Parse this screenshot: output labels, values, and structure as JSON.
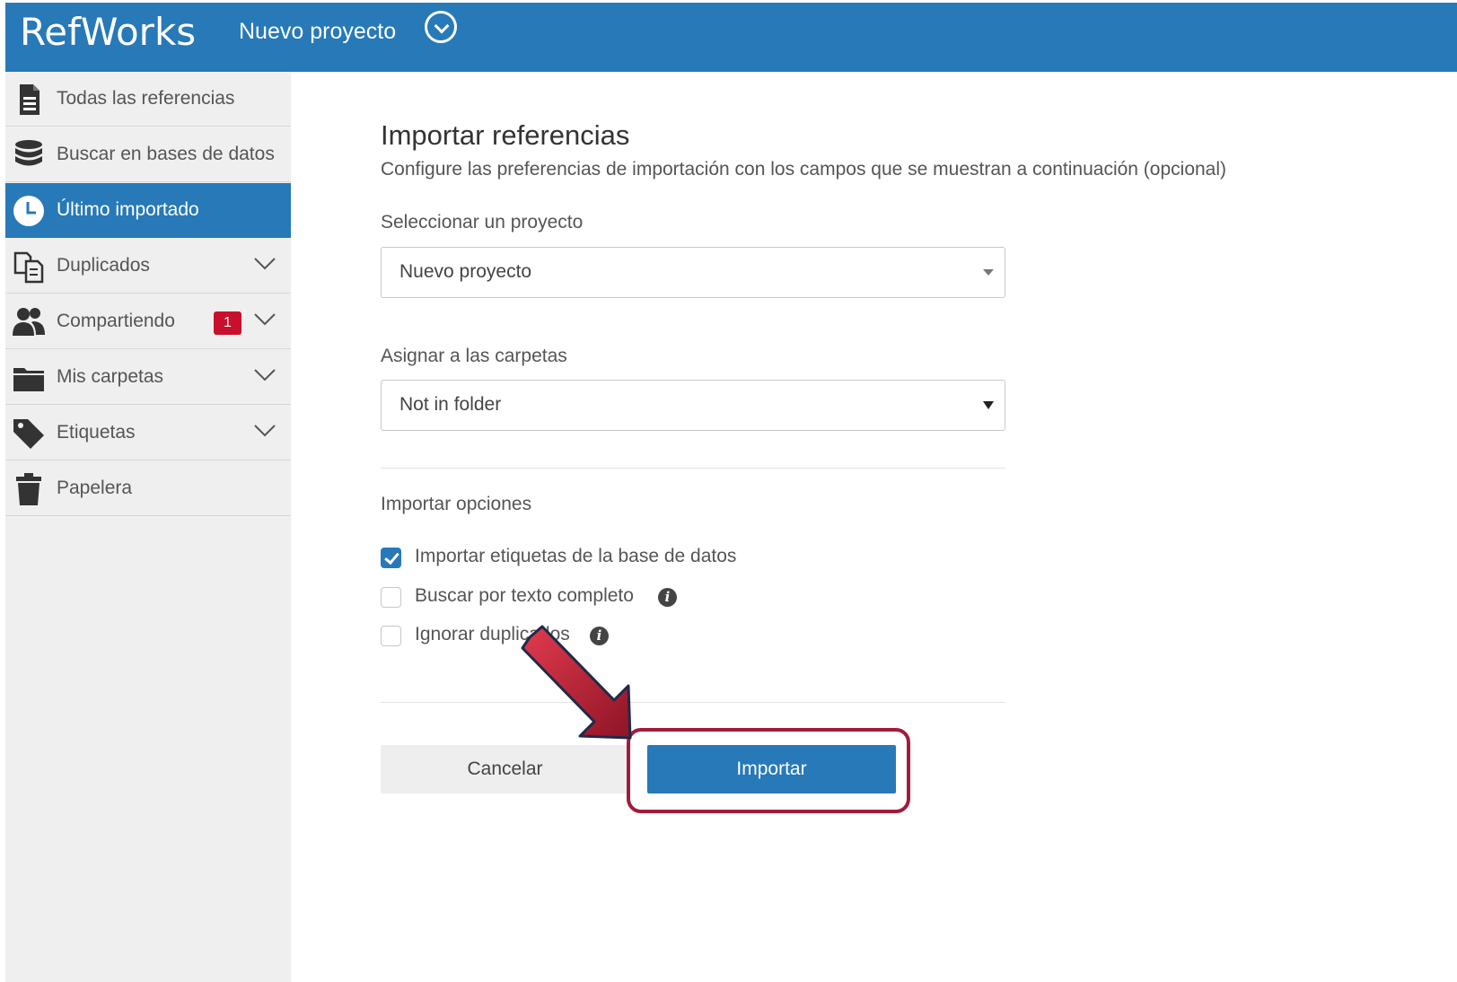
{
  "header": {
    "logo": "RefWorks",
    "project_name": "Nuevo proyecto"
  },
  "sidebar": {
    "items": [
      {
        "label": "Todas las referencias",
        "icon": "document-icon"
      },
      {
        "label": "Buscar en bases de datos",
        "icon": "database-icon"
      },
      {
        "label": "Último importado",
        "icon": "clock-icon",
        "active": true
      },
      {
        "label": "Duplicados",
        "icon": "duplicate-icon",
        "expandable": true
      },
      {
        "label": "Compartiendo",
        "icon": "users-icon",
        "expandable": true,
        "badge": "1"
      },
      {
        "label": "Mis carpetas",
        "icon": "folder-icon",
        "expandable": true
      },
      {
        "label": "Etiquetas",
        "icon": "tag-icon",
        "expandable": true
      },
      {
        "label": "Papelera",
        "icon": "trash-icon"
      }
    ]
  },
  "main": {
    "title": "Importar referencias",
    "subtitle": "Configure las preferencias de importación con los campos que se muestran a continuación (opcional)",
    "project_select": {
      "label": "Seleccionar un proyecto",
      "value": "Nuevo proyecto"
    },
    "folder_select": {
      "label": "Asignar a las carpetas",
      "value": "Not in folder"
    },
    "options": {
      "label": "Importar opciones",
      "items": [
        {
          "label": "Importar etiquetas de la base de datos",
          "checked": true,
          "info": false
        },
        {
          "label": "Buscar por texto completo",
          "checked": false,
          "info": true
        },
        {
          "label": "Ignorar duplicados",
          "checked": false,
          "info": true
        }
      ]
    },
    "buttons": {
      "cancel": "Cancelar",
      "import": "Importar"
    }
  },
  "colors": {
    "brand_blue": "#2779b8",
    "badge_red": "#c8102e",
    "highlight": "#a01c3c"
  }
}
